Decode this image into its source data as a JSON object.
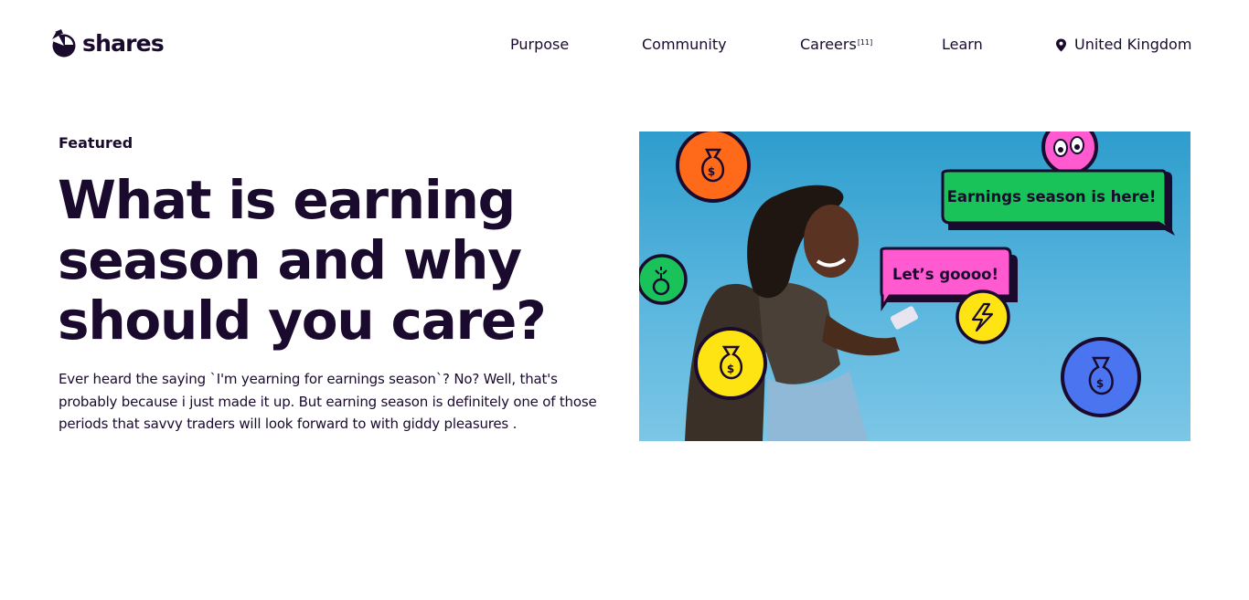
{
  "brand": {
    "name": "shares"
  },
  "nav": {
    "items": [
      {
        "label": "Purpose"
      },
      {
        "label": "Community"
      },
      {
        "label": "Careers",
        "badge": "[11]"
      },
      {
        "label": "Learn"
      }
    ],
    "region": {
      "label": "United Kingdom",
      "icon": "location-pin-icon"
    }
  },
  "featured": {
    "label": "Featured",
    "title": "What is earning season and why should you care?",
    "excerpt": "Ever heard the saying `I'm yearning for earnings season`? No? Well, that's probably because i just made it up. But earning season is definitely one of those periods that savvy traders will look forward to with giddy pleasures ."
  },
  "hero": {
    "bubble_1": "Earnings season is here!",
    "bubble_2": "Let’s goooo!",
    "colors": {
      "sky": "#3aa3d3",
      "green": "#19c35a",
      "pink": "#ff5ad0",
      "yellow": "#ffe414",
      "orange": "#ff6a1a",
      "blue": "#4a74f0",
      "outline": "#1a0a2e"
    }
  }
}
